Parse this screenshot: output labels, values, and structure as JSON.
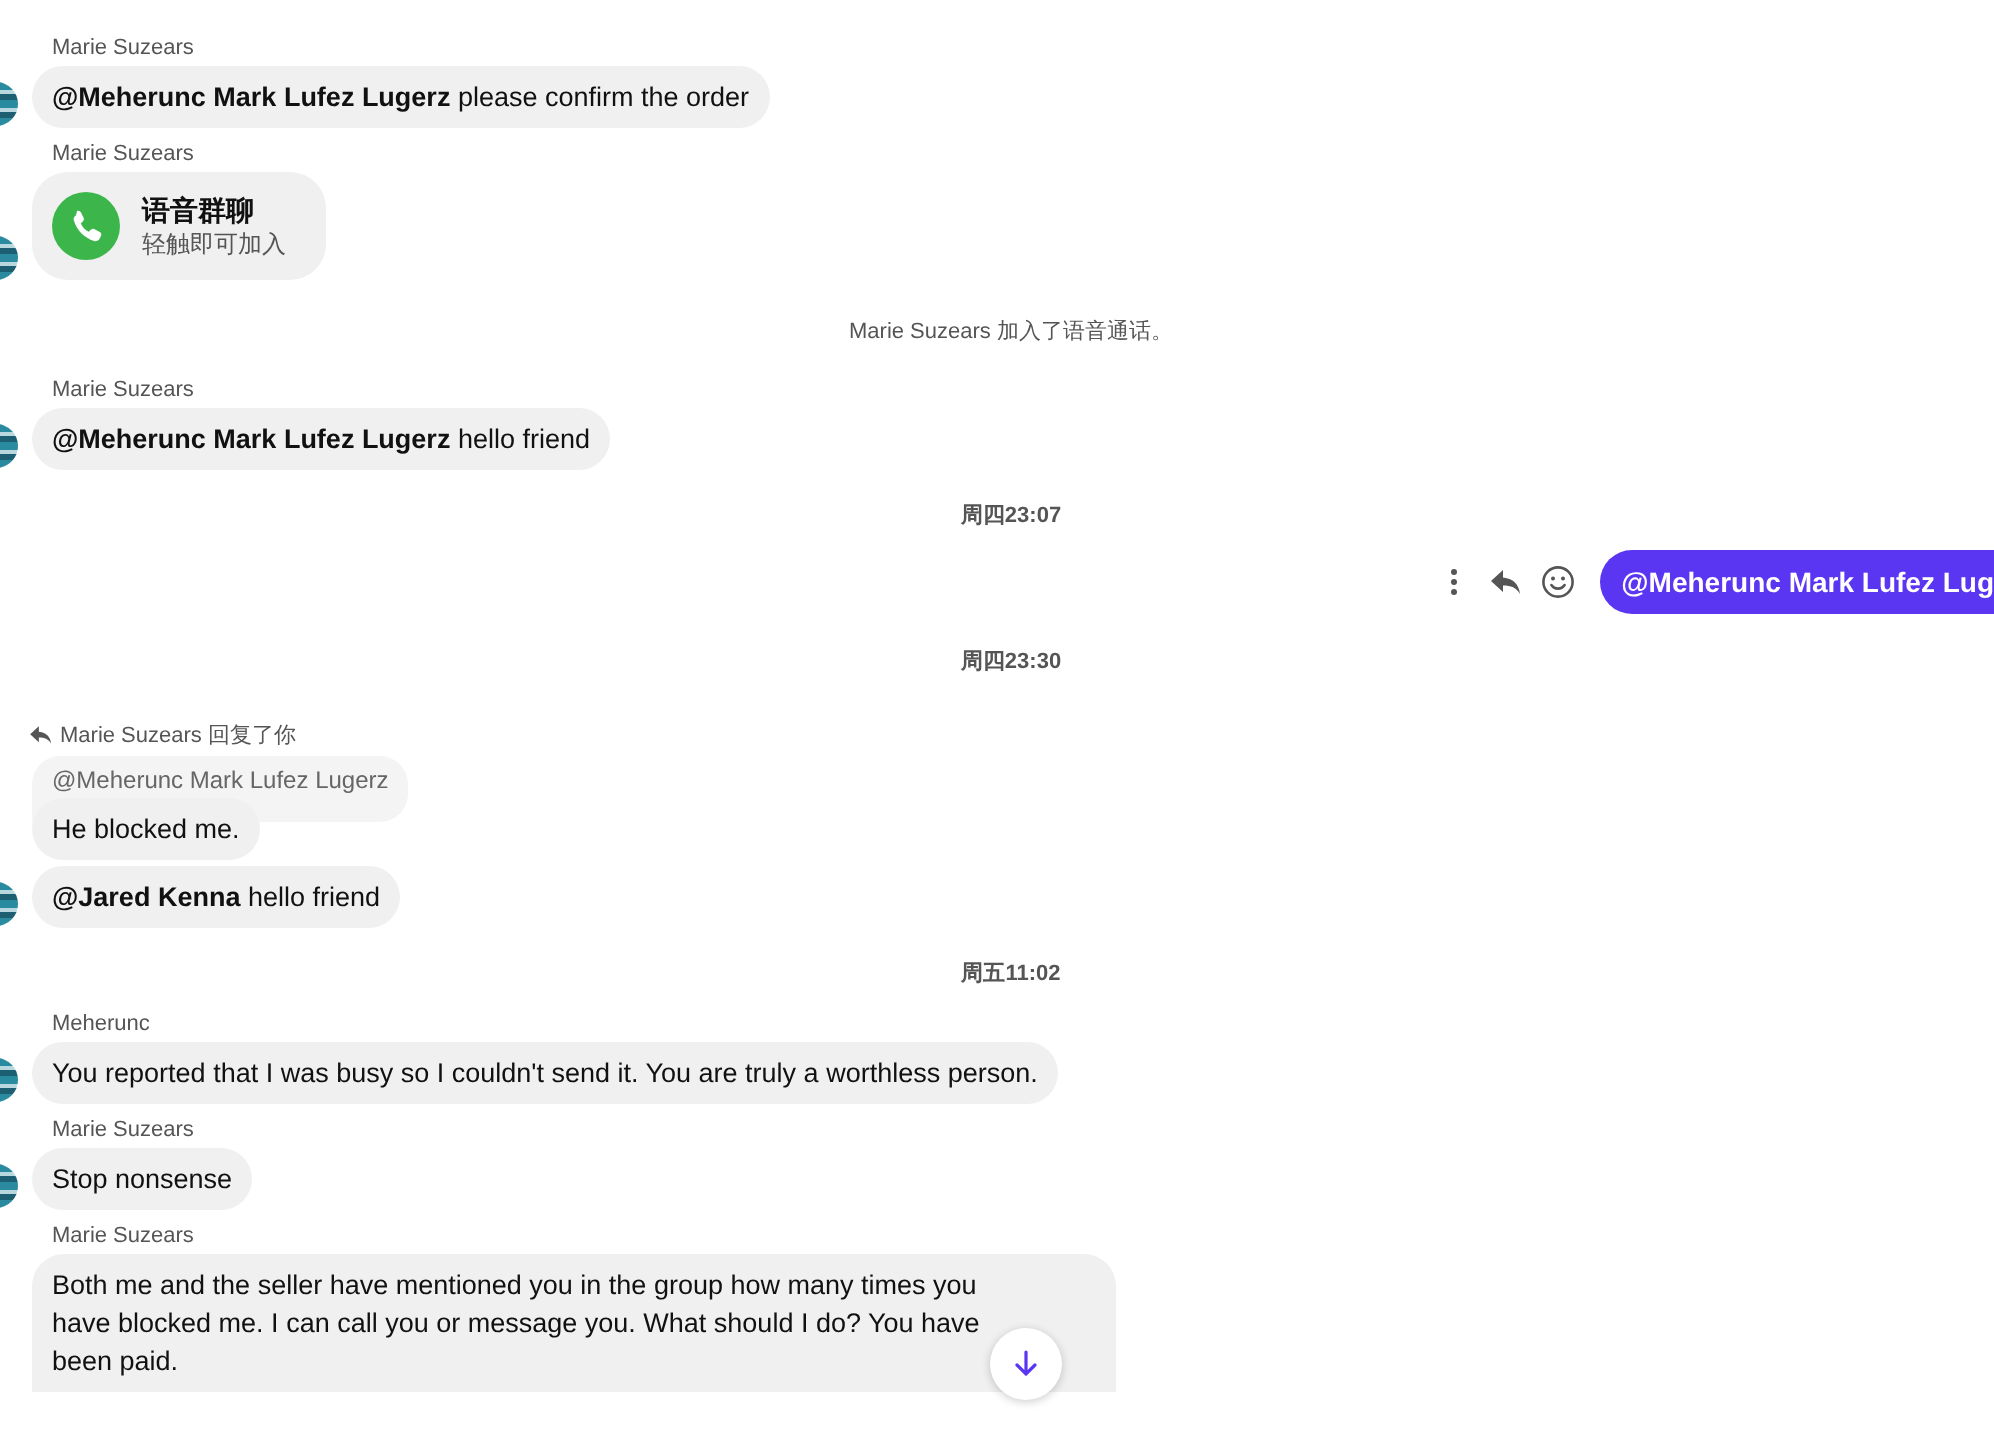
{
  "messages": [
    {
      "kind": "message",
      "sender": "Marie Suzears",
      "text": "**@Meherunc Mark Lufez Lugerz** please confirm the order",
      "avatar": true
    },
    {
      "kind": "call",
      "sender": "Marie Suzears",
      "title": "语音群聊",
      "subtitle": "轻触即可加入",
      "avatar": true
    },
    {
      "kind": "system",
      "text": "Marie Suzears 加入了语音通话。"
    },
    {
      "kind": "message",
      "sender": "Marie Suzears",
      "text": "**@Meherunc Mark Lufez Lugerz** hello friend",
      "avatar": true
    },
    {
      "kind": "time",
      "text": "周四23:07"
    },
    {
      "kind": "outgoing",
      "text": "@Meherunc Mark Lufez Lug"
    },
    {
      "kind": "time",
      "text": "周四23:30"
    },
    {
      "kind": "reply",
      "header": "Marie Suzears 回复了你",
      "quote": "@Meherunc Mark Lufez Lugerz",
      "text": "He blocked me."
    },
    {
      "kind": "message",
      "text": "**@Jared Kenna** hello friend",
      "avatar": true
    },
    {
      "kind": "time",
      "text": "周五11:02"
    },
    {
      "kind": "message",
      "sender": "Meherunc",
      "text": "You reported that I was busy so I couldn't send it. You are truly a worthless person.",
      "avatar": true
    },
    {
      "kind": "message",
      "sender": "Marie Suzears",
      "text": "Stop nonsense",
      "avatar": true
    },
    {
      "kind": "message",
      "sender": "Marie Suzears",
      "text": "Both me and the seller have mentioned you in the group how many times you have blocked me. I can call you or message you. What should I do? You have been paid.",
      "avatar": false
    }
  ]
}
